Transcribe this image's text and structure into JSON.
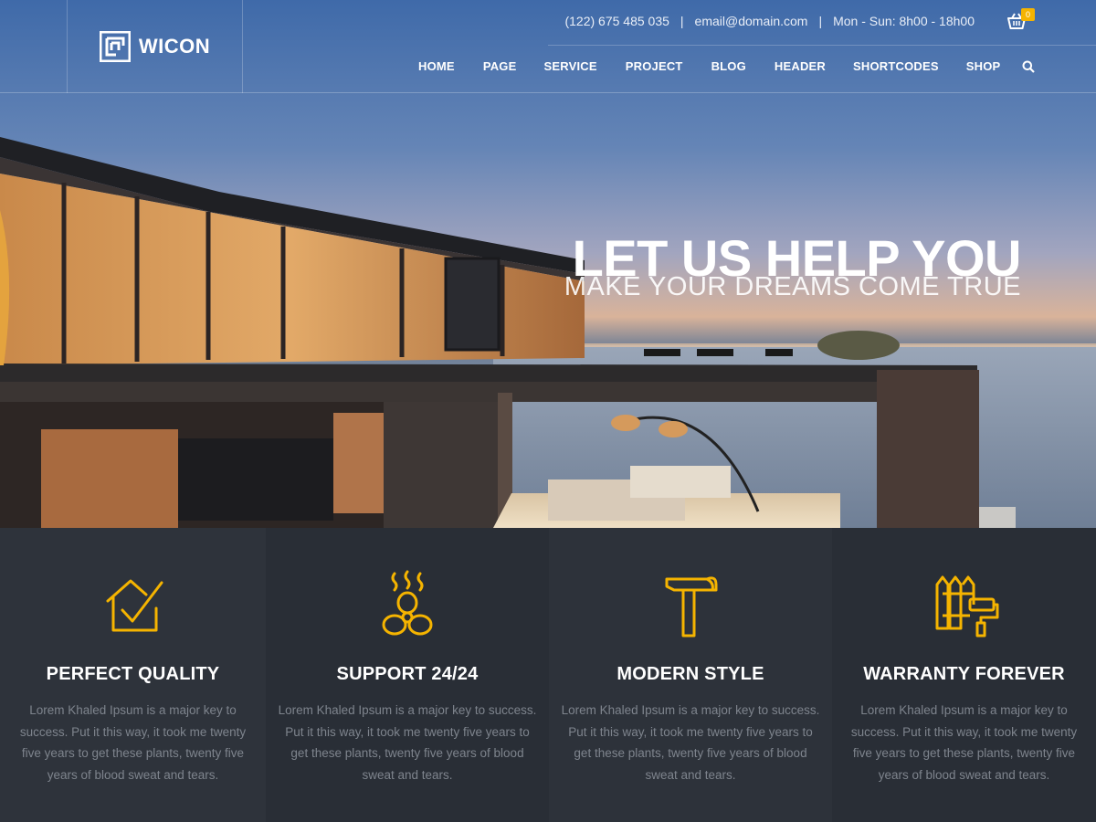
{
  "brand": {
    "name": "WICON"
  },
  "topbar": {
    "phone": "(122) 675 485 035",
    "separator": "|",
    "email": "email@domain.com",
    "hours": "Mon - Sun: 8h00 - 18h00",
    "cart_count": "0"
  },
  "nav": {
    "items": [
      {
        "label": "HOME"
      },
      {
        "label": "PAGE"
      },
      {
        "label": "SERVICE"
      },
      {
        "label": "PROJECT"
      },
      {
        "label": "BLOG"
      },
      {
        "label": "HEADER"
      },
      {
        "label": "SHORTCODES"
      },
      {
        "label": "SHOP"
      }
    ]
  },
  "hero": {
    "title": "LET US HELP YOU",
    "subtitle": "MAKE YOUR DREAMS COME TRUE"
  },
  "features": [
    {
      "icon": "house-check-icon",
      "title": "PERFECT QUALITY",
      "text": "Lorem Khaled Ipsum is a major key to success. Put it this way, it took me twenty five years to get these plants, twenty five years of blood sweat and tears."
    },
    {
      "icon": "fan-icon",
      "title": "SUPPORT 24/24",
      "text": "Lorem Khaled Ipsum is a major key to success. Put it this way, it took me twenty five years to get these plants, twenty five years of blood sweat and tears."
    },
    {
      "icon": "hammer-icon",
      "title": "MODERN STYLE",
      "text": "Lorem Khaled Ipsum is a major key to success. Put it this way, it took me twenty five years to get these plants, twenty five years of blood sweat and tears."
    },
    {
      "icon": "fence-roller-icon",
      "title": "WARRANTY FOREVER",
      "text": "Lorem Khaled Ipsum is a major key to success. Put it this way, it took me twenty five years to get these plants, twenty five years of blood sweat and tears."
    }
  ],
  "colors": {
    "accent": "#f5b400",
    "dark_bg": "#2b3038",
    "text_muted": "#7e848d"
  }
}
